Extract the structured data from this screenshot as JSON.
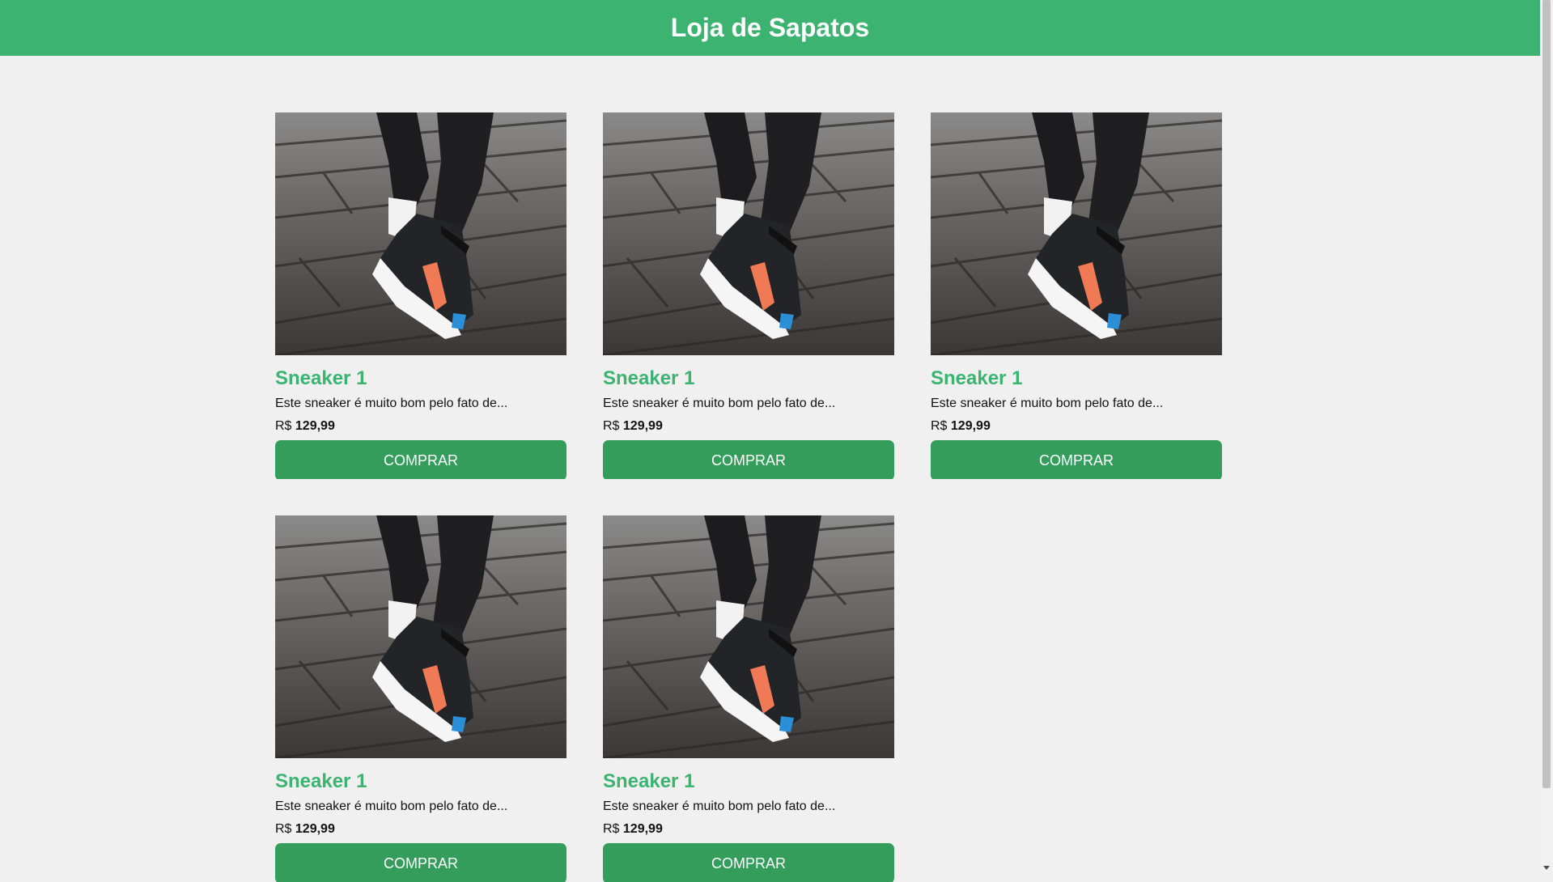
{
  "header": {
    "title": "Loja de Sapatos"
  },
  "colors": {
    "brand": "#3cb371",
    "button": "#349d5c",
    "background": "#f0f0f0"
  },
  "products": [
    {
      "name": "Sneaker 1",
      "description": "Este sneaker é muito bom pelo fato de...",
      "currency": "R$",
      "price": "129,99",
      "button": "COMPRAR",
      "image_icon": "sneaker-photo"
    },
    {
      "name": "Sneaker 1",
      "description": "Este sneaker é muito bom pelo fato de...",
      "currency": "R$",
      "price": "129,99",
      "button": "COMPRAR",
      "image_icon": "sneaker-photo"
    },
    {
      "name": "Sneaker 1",
      "description": "Este sneaker é muito bom pelo fato de...",
      "currency": "R$",
      "price": "129,99",
      "button": "COMPRAR",
      "image_icon": "sneaker-photo"
    },
    {
      "name": "Sneaker 1",
      "description": "Este sneaker é muito bom pelo fato de...",
      "currency": "R$",
      "price": "129,99",
      "button": "COMPRAR",
      "image_icon": "sneaker-photo"
    },
    {
      "name": "Sneaker 1",
      "description": "Este sneaker é muito bom pelo fato de...",
      "currency": "R$",
      "price": "129,99",
      "button": "COMPRAR",
      "image_icon": "sneaker-photo"
    }
  ]
}
